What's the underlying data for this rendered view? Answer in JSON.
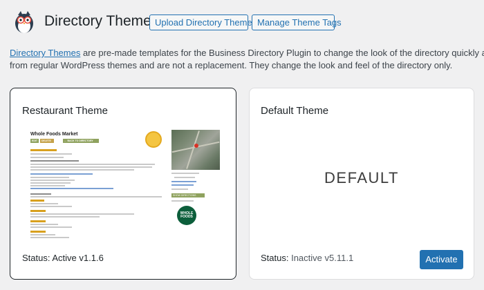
{
  "header": {
    "title": "Directory Themes",
    "upload_button": "Upload Directory Theme",
    "manage_button": "Manage Theme Tags"
  },
  "intro": {
    "link_text": "Directory Themes",
    "line1_rest": " are pre-made templates for the Business Directory Plugin to change the look of the directory quickly and easily. We have",
    "line2": "from regular WordPress themes and are not a replacement. They change the look and feel of the directory only."
  },
  "themes": [
    {
      "name": "Restaurant Theme",
      "status_label": "Status:",
      "status_value": "Active v1.1.6",
      "preview": {
        "listing_title": "Whole Foods Market",
        "button_edit": "EDIT",
        "button_delete": "DELETE",
        "button_back": "← BACK TO DIRECTORY",
        "button_directions": "SHOW DIRECTIONS",
        "logo_text": "WHOLE FOODS"
      }
    },
    {
      "name": "Default Theme",
      "status_label": "Status:",
      "status_value": "Inactive v5.11.1",
      "preview_text": "DEFAULT",
      "action_button": "Activate"
    }
  ],
  "colors": {
    "accent": "#2271b1",
    "page_bg": "#f0f0f1",
    "card_bg": "#ffffff"
  }
}
